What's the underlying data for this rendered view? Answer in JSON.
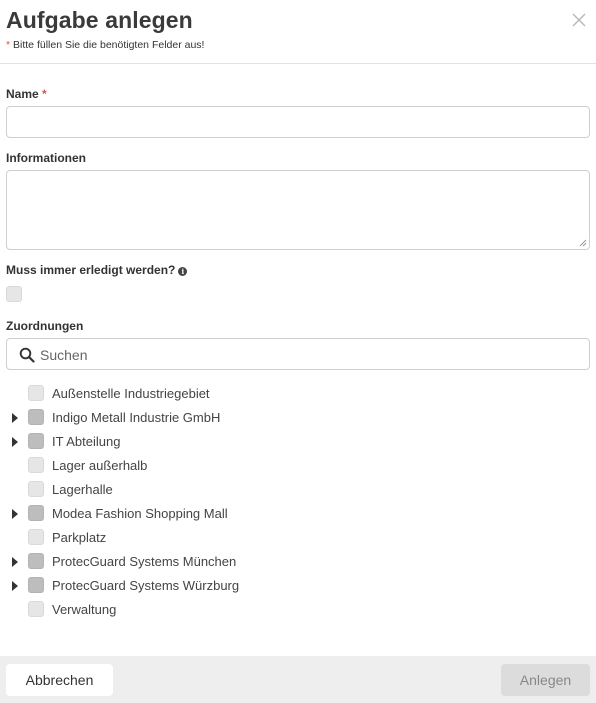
{
  "dialog": {
    "title": "Aufgabe anlegen",
    "required_marker": "*",
    "subtitle": " Bitte füllen Sie die benötigten Felder aus!"
  },
  "fields": {
    "name_label": "Name",
    "name_required": " *",
    "name_value": "",
    "info_label": "Informationen",
    "info_value": "",
    "must_label": "Muss immer erledigt werden?",
    "must_info_icon": "info-circle-icon",
    "must_checked": false,
    "assign_label": "Zuordnungen"
  },
  "search": {
    "placeholder": "Suchen",
    "icon": "search-icon"
  },
  "tree": [
    {
      "label": "Außenstelle Industriegebiet",
      "expandable": false,
      "checked": false
    },
    {
      "label": "Indigo Metall Industrie GmbH",
      "expandable": true,
      "checked": false
    },
    {
      "label": "IT Abteilung",
      "expandable": true,
      "checked": false
    },
    {
      "label": "Lager außerhalb",
      "expandable": false,
      "checked": false
    },
    {
      "label": "Lagerhalle",
      "expandable": false,
      "checked": false
    },
    {
      "label": "Modea Fashion Shopping Mall",
      "expandable": true,
      "checked": false
    },
    {
      "label": "Parkplatz",
      "expandable": false,
      "checked": false
    },
    {
      "label": "ProtecGuard Systems München",
      "expandable": true,
      "checked": false
    },
    {
      "label": "ProtecGuard Systems Würzburg",
      "expandable": true,
      "checked": false
    },
    {
      "label": "Verwaltung",
      "expandable": false,
      "checked": false
    }
  ],
  "footer": {
    "cancel_label": "Abbrechen",
    "submit_label": "Anlegen"
  },
  "colors": {
    "required": "#d9534f",
    "footer_bg": "#eeeeee",
    "submit_disabled_bg": "#dcdcdc"
  }
}
